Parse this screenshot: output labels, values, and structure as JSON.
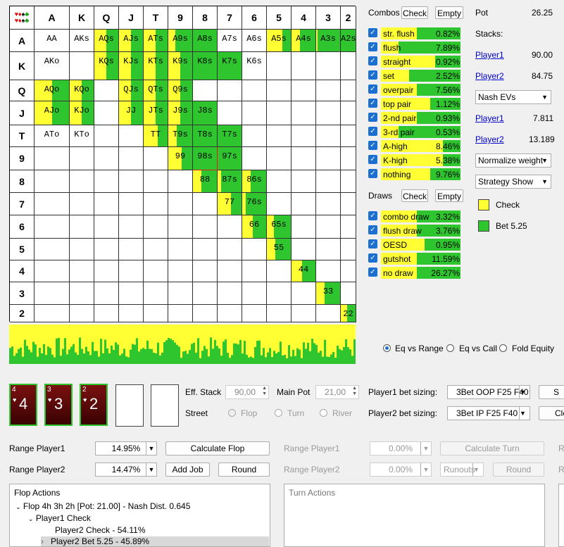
{
  "grid": {
    "corner_suits": "♥♦♠♣",
    "ranks": [
      "A",
      "K",
      "Q",
      "J",
      "T",
      "9",
      "8",
      "7",
      "6",
      "5",
      "4",
      "3",
      "2"
    ],
    "cells": [
      [
        "AA",
        "AKs",
        "AQs",
        "AJs",
        "ATs",
        "A9s",
        "A8s",
        "A7s",
        "A6s",
        "A5s",
        "A4s",
        "A3s",
        "A2s"
      ],
      [
        "AKo",
        "",
        "KQs",
        "KJs",
        "KTs",
        "K9s",
        "K8s",
        "K7s",
        "K6s",
        "",
        "",
        "",
        ""
      ],
      [
        "AQo",
        "KQo",
        "",
        "QJs",
        "QTs",
        "Q9s",
        "",
        "",
        "",
        "",
        "",
        "",
        ""
      ],
      [
        "AJo",
        "KJo",
        "",
        "JJ",
        "JTs",
        "J9s",
        "J8s",
        "",
        "",
        "",
        "",
        "",
        ""
      ],
      [
        "ATo",
        "KTo",
        "",
        "",
        "TT",
        "T9s",
        "T8s",
        "T7s",
        "",
        "",
        "",
        "",
        ""
      ],
      [
        "",
        "",
        "",
        "",
        "",
        "99",
        "98s",
        "97s",
        "",
        "",
        "",
        "",
        ""
      ],
      [
        "",
        "",
        "",
        "",
        "",
        "",
        "88",
        "87s",
        "86s",
        "",
        "",
        "",
        ""
      ],
      [
        "",
        "",
        "",
        "",
        "",
        "",
        "",
        "77",
        "76s",
        "",
        "",
        "",
        ""
      ],
      [
        "",
        "",
        "",
        "",
        "",
        "",
        "",
        "",
        "66",
        "65s",
        "",
        "",
        ""
      ],
      [
        "",
        "",
        "",
        "",
        "",
        "",
        "",
        "",
        "",
        "55",
        "",
        "",
        ""
      ],
      [
        "",
        "",
        "",
        "",
        "",
        "",
        "",
        "",
        "",
        "",
        "44",
        "",
        ""
      ],
      [
        "",
        "",
        "",
        "",
        "",
        "",
        "",
        "",
        "",
        "",
        "",
        "33",
        ""
      ],
      [
        "",
        "",
        "",
        "",
        "",
        "",
        "",
        "",
        "",
        "",
        "",
        "",
        "22"
      ]
    ],
    "selected": "98s"
  },
  "combos": {
    "title": "Combos",
    "check_label": "Check",
    "empty_label": "Empty",
    "rows": [
      {
        "name": "str. flush",
        "pct": "0.82%",
        "check": 0.45
      },
      {
        "name": "flush",
        "pct": "7.89%",
        "check": 0.22
      },
      {
        "name": "straight",
        "pct": "0.92%",
        "check": 0.68
      },
      {
        "name": "set",
        "pct": "2.52%",
        "check": 0.35
      },
      {
        "name": "overpair",
        "pct": "7.56%",
        "check": 0.45
      },
      {
        "name": "top pair",
        "pct": "1.12%",
        "check": 0.62
      },
      {
        "name": "2-nd pair",
        "pct": "0.93%",
        "check": 0.45
      },
      {
        "name": "3-rd pair",
        "pct": "0.53%",
        "check": 0.22
      },
      {
        "name": "A-high",
        "pct": "8.46%",
        "check": 0.78
      },
      {
        "name": "K-high",
        "pct": "5.38%",
        "check": 0.78
      },
      {
        "name": "nothing",
        "pct": "9.76%",
        "check": 0.62
      }
    ]
  },
  "draws": {
    "title": "Draws",
    "check_label": "Check",
    "empty_label": "Empty",
    "rows": [
      {
        "name": "combo draw",
        "pct": "3.32%",
        "check": 0.45
      },
      {
        "name": "flush draw",
        "pct": "3.76%",
        "check": 0.45
      },
      {
        "name": "OESD",
        "pct": "0.95%",
        "check": 0.55
      },
      {
        "name": "gutshot",
        "pct": "11.59%",
        "check": 0.45
      },
      {
        "name": "no draw",
        "pct": "26.27%",
        "check": 0.45
      }
    ]
  },
  "info": {
    "pot_label": "Pot",
    "pot": "26.25",
    "stacks_label": "Stacks:",
    "p1": "Player1",
    "p1_stack": "90.00",
    "p2": "Player2",
    "p2_stack": "84.75",
    "ev_select": "Nash EVs",
    "p1_ev": "7.811",
    "p2_ev": "13.189",
    "normalize": "Normalize weight",
    "strategy": "Strategy Show",
    "legend_check": "Check",
    "legend_bet": "Bet 5.25"
  },
  "colors": {
    "check": "#ffff33",
    "bet": "#2ec52e"
  },
  "eq": {
    "options": [
      "Eq vs Range",
      "Eq vs Call",
      "Fold Equity"
    ],
    "selected": 0
  },
  "board": {
    "cards": [
      {
        "rank": "4",
        "suit": "♥"
      },
      {
        "rank": "3",
        "suit": "♥"
      },
      {
        "rank": "2",
        "suit": "♥"
      }
    ]
  },
  "settings": {
    "eff_stack_label": "Eff. Stack",
    "eff_stack": "90,00",
    "main_pot_label": "Main Pot",
    "main_pot": "21,00",
    "street_label": "Street",
    "streets": [
      "Flop",
      "Turn",
      "River"
    ],
    "p1_bet_label": "Player1 bet sizing:",
    "p1_bet": "3Bet OOP F25 F40",
    "p2_bet_label": "Player2 bet sizing:",
    "p2_bet": "3Bet IP F25 F40",
    "btn_s": "S",
    "btn_cle": "Cle"
  },
  "flop_ctrl": {
    "range1_label": "Range Player1",
    "range1": "14.95%",
    "range2_label": "Range Player2",
    "range2": "14.47%",
    "calc": "Calculate Flop",
    "add_job": "Add Job",
    "round": "Round"
  },
  "turn_ctrl": {
    "range1_label": "Range Player1",
    "range1": "0.00%",
    "range2_label": "Range Player2",
    "range2": "0.00%",
    "calc": "Calculate Turn",
    "runouts": "Runouts",
    "round": "Round",
    "r1": "R",
    "r2": "R"
  },
  "flop_actions": {
    "title": "Flop Actions",
    "root": "Flop 4h 3h 2h [Pot: 21.00] - Nash Dist. 0.645",
    "child": "Player1 Check",
    "leaf1": "Player2 Check - 54.11%",
    "leaf2": "Player2 Bet 5.25 - 45.89%"
  },
  "turn_actions": {
    "title": "Turn Actions"
  }
}
